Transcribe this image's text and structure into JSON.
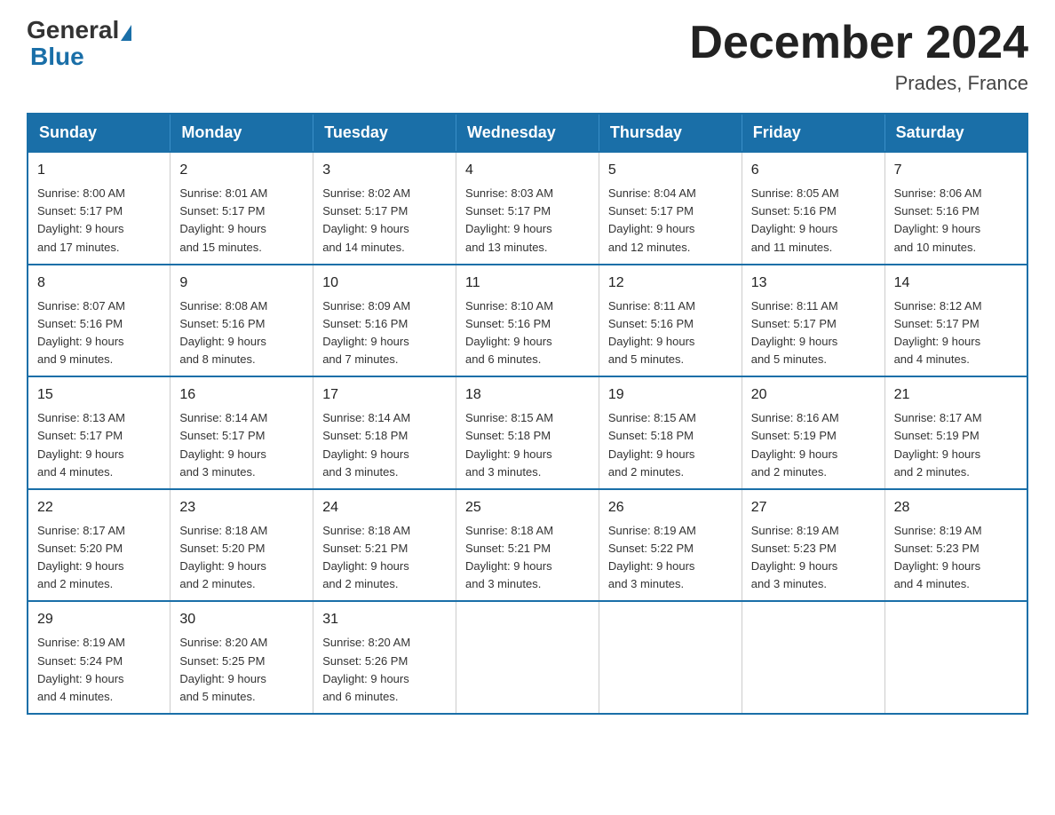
{
  "header": {
    "logo": {
      "general": "General",
      "blue": "Blue"
    },
    "title": "December 2024",
    "location": "Prades, France"
  },
  "calendar": {
    "days_of_week": [
      "Sunday",
      "Monday",
      "Tuesday",
      "Wednesday",
      "Thursday",
      "Friday",
      "Saturday"
    ],
    "weeks": [
      [
        {
          "day": "1",
          "sunrise": "8:00 AM",
          "sunset": "5:17 PM",
          "daylight": "9 hours and 17 minutes."
        },
        {
          "day": "2",
          "sunrise": "8:01 AM",
          "sunset": "5:17 PM",
          "daylight": "9 hours and 15 minutes."
        },
        {
          "day": "3",
          "sunrise": "8:02 AM",
          "sunset": "5:17 PM",
          "daylight": "9 hours and 14 minutes."
        },
        {
          "day": "4",
          "sunrise": "8:03 AM",
          "sunset": "5:17 PM",
          "daylight": "9 hours and 13 minutes."
        },
        {
          "day": "5",
          "sunrise": "8:04 AM",
          "sunset": "5:17 PM",
          "daylight": "9 hours and 12 minutes."
        },
        {
          "day": "6",
          "sunrise": "8:05 AM",
          "sunset": "5:16 PM",
          "daylight": "9 hours and 11 minutes."
        },
        {
          "day": "7",
          "sunrise": "8:06 AM",
          "sunset": "5:16 PM",
          "daylight": "9 hours and 10 minutes."
        }
      ],
      [
        {
          "day": "8",
          "sunrise": "8:07 AM",
          "sunset": "5:16 PM",
          "daylight": "9 hours and 9 minutes."
        },
        {
          "day": "9",
          "sunrise": "8:08 AM",
          "sunset": "5:16 PM",
          "daylight": "9 hours and 8 minutes."
        },
        {
          "day": "10",
          "sunrise": "8:09 AM",
          "sunset": "5:16 PM",
          "daylight": "9 hours and 7 minutes."
        },
        {
          "day": "11",
          "sunrise": "8:10 AM",
          "sunset": "5:16 PM",
          "daylight": "9 hours and 6 minutes."
        },
        {
          "day": "12",
          "sunrise": "8:11 AM",
          "sunset": "5:16 PM",
          "daylight": "9 hours and 5 minutes."
        },
        {
          "day": "13",
          "sunrise": "8:11 AM",
          "sunset": "5:17 PM",
          "daylight": "9 hours and 5 minutes."
        },
        {
          "day": "14",
          "sunrise": "8:12 AM",
          "sunset": "5:17 PM",
          "daylight": "9 hours and 4 minutes."
        }
      ],
      [
        {
          "day": "15",
          "sunrise": "8:13 AM",
          "sunset": "5:17 PM",
          "daylight": "9 hours and 4 minutes."
        },
        {
          "day": "16",
          "sunrise": "8:14 AM",
          "sunset": "5:17 PM",
          "daylight": "9 hours and 3 minutes."
        },
        {
          "day": "17",
          "sunrise": "8:14 AM",
          "sunset": "5:18 PM",
          "daylight": "9 hours and 3 minutes."
        },
        {
          "day": "18",
          "sunrise": "8:15 AM",
          "sunset": "5:18 PM",
          "daylight": "9 hours and 3 minutes."
        },
        {
          "day": "19",
          "sunrise": "8:15 AM",
          "sunset": "5:18 PM",
          "daylight": "9 hours and 2 minutes."
        },
        {
          "day": "20",
          "sunrise": "8:16 AM",
          "sunset": "5:19 PM",
          "daylight": "9 hours and 2 minutes."
        },
        {
          "day": "21",
          "sunrise": "8:17 AM",
          "sunset": "5:19 PM",
          "daylight": "9 hours and 2 minutes."
        }
      ],
      [
        {
          "day": "22",
          "sunrise": "8:17 AM",
          "sunset": "5:20 PM",
          "daylight": "9 hours and 2 minutes."
        },
        {
          "day": "23",
          "sunrise": "8:18 AM",
          "sunset": "5:20 PM",
          "daylight": "9 hours and 2 minutes."
        },
        {
          "day": "24",
          "sunrise": "8:18 AM",
          "sunset": "5:21 PM",
          "daylight": "9 hours and 2 minutes."
        },
        {
          "day": "25",
          "sunrise": "8:18 AM",
          "sunset": "5:21 PM",
          "daylight": "9 hours and 3 minutes."
        },
        {
          "day": "26",
          "sunrise": "8:19 AM",
          "sunset": "5:22 PM",
          "daylight": "9 hours and 3 minutes."
        },
        {
          "day": "27",
          "sunrise": "8:19 AM",
          "sunset": "5:23 PM",
          "daylight": "9 hours and 3 minutes."
        },
        {
          "day": "28",
          "sunrise": "8:19 AM",
          "sunset": "5:23 PM",
          "daylight": "9 hours and 4 minutes."
        }
      ],
      [
        {
          "day": "29",
          "sunrise": "8:19 AM",
          "sunset": "5:24 PM",
          "daylight": "9 hours and 4 minutes."
        },
        {
          "day": "30",
          "sunrise": "8:20 AM",
          "sunset": "5:25 PM",
          "daylight": "9 hours and 5 minutes."
        },
        {
          "day": "31",
          "sunrise": "8:20 AM",
          "sunset": "5:26 PM",
          "daylight": "9 hours and 6 minutes."
        },
        null,
        null,
        null,
        null
      ]
    ],
    "labels": {
      "sunrise": "Sunrise:",
      "sunset": "Sunset:",
      "daylight": "Daylight:"
    }
  }
}
